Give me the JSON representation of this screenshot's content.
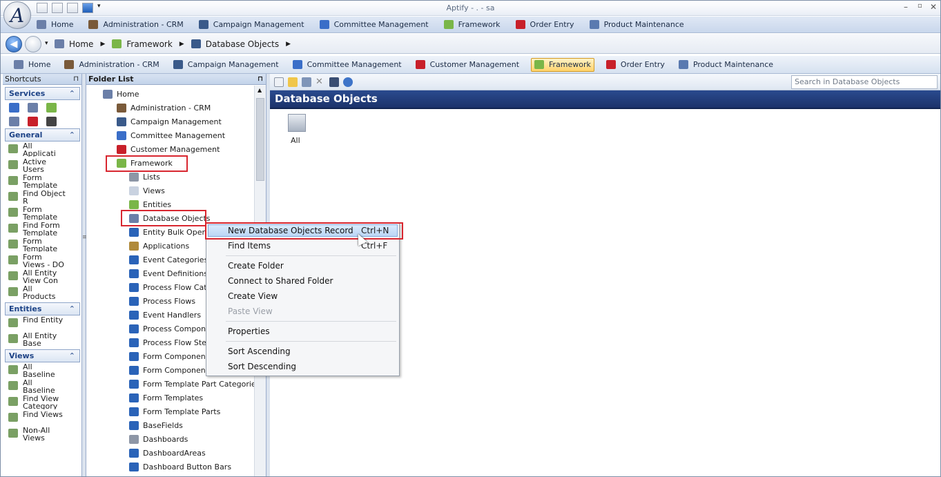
{
  "window": {
    "title": "Aptify - . - sa"
  },
  "toolbar1": {
    "items": [
      "Home",
      "Administration - CRM",
      "Campaign Management",
      "Committee Management",
      "Framework",
      "Order Entry",
      "Product Maintenance"
    ]
  },
  "breadcrumb": {
    "items": [
      "Home",
      "Framework",
      "Database Objects"
    ]
  },
  "toolbar2": {
    "items": [
      "Home",
      "Administration - CRM",
      "Campaign Management",
      "Committee Management",
      "Customer Management",
      "Framework",
      "Order Entry",
      "Product Maintenance"
    ],
    "selected": "Framework"
  },
  "shortcuts": {
    "title": "Shortcuts",
    "groups": [
      {
        "label": "Services",
        "items": []
      },
      {
        "label": "General",
        "items": [
          "All Applicati",
          "Active Users",
          "Form Template",
          "Find Object R",
          "Form Template",
          "Find Form Template",
          "Form Template",
          "Form Views - DO",
          "All Entity View Con",
          "All Products"
        ]
      },
      {
        "label": "Entities",
        "items": [
          "Find Entity",
          "All Entity Base Views"
        ]
      },
      {
        "label": "Views",
        "items": [
          "All Baseline",
          "All Baseline",
          "Find View Category",
          "Find Views",
          "Non-All Views"
        ]
      }
    ]
  },
  "folder_list": {
    "title": "Folder List",
    "root": "Home",
    "level1": [
      "Administration - CRM",
      "Campaign Management",
      "Committee Management",
      "Customer Management",
      "Framework"
    ],
    "framework_children": [
      "Lists",
      "Views",
      "Entities",
      "Database Objects",
      "Entity Bulk Operat",
      "Applications",
      "Event Categories",
      "Event Definitions",
      "Process Flow Cate",
      "Process Flows",
      "Event Handlers",
      "Process Compone",
      "Process Flow Step",
      "Form Component",
      "Form Component",
      "Form Template Part Categories",
      "Form Templates",
      "Form Template Parts",
      "BaseFields",
      "Dashboards",
      "DashboardAreas",
      "Dashboard Button Bars"
    ]
  },
  "content": {
    "search_placeholder": "Search in Database Objects",
    "header": "Database Objects",
    "item_label": "All"
  },
  "context_menu": {
    "items": [
      {
        "label": "New Database Objects Record",
        "shortcut": "Ctrl+N"
      },
      {
        "label": "Find Items",
        "shortcut": "Ctrl+F"
      },
      {
        "label": "Create Folder",
        "shortcut": ""
      },
      {
        "label": "Connect to Shared Folder",
        "shortcut": ""
      },
      {
        "label": "Create View",
        "shortcut": ""
      },
      {
        "label": "Paste View",
        "shortcut": ""
      },
      {
        "label": "Properties",
        "shortcut": ""
      },
      {
        "label": "Sort Ascending",
        "shortcut": ""
      },
      {
        "label": "Sort Descending",
        "shortcut": ""
      }
    ]
  },
  "colors": {
    "header_bg": "#1c336b",
    "highlight": "#d8262f",
    "selected_tab": "#ffd36b"
  },
  "icons": [
    "logo",
    "home-icon",
    "briefcase-icon",
    "monitor-icon",
    "people-icon",
    "framework-icon",
    "cart-icon",
    "product-icon",
    "book-icon",
    "database-icon",
    "list-icon"
  ]
}
